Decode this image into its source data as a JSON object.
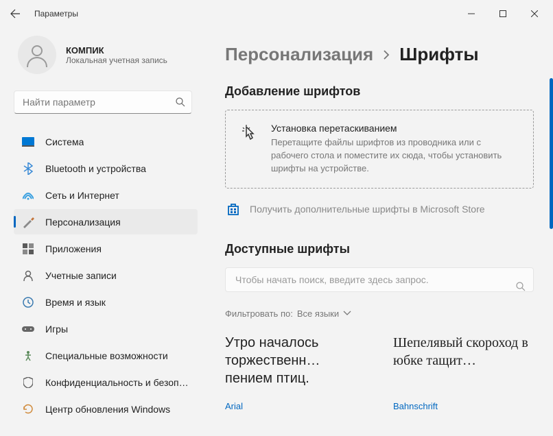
{
  "window": {
    "title": "Параметры"
  },
  "profile": {
    "name": "КОМПИК",
    "subtitle": "Локальная учетная запись"
  },
  "search": {
    "placeholder": "Найти параметр"
  },
  "nav": [
    {
      "id": "system",
      "label": "Система"
    },
    {
      "id": "bluetooth",
      "label": "Bluetooth и устройства"
    },
    {
      "id": "network",
      "label": "Сеть и Интернет"
    },
    {
      "id": "personalization",
      "label": "Персонализация"
    },
    {
      "id": "apps",
      "label": "Приложения"
    },
    {
      "id": "accounts",
      "label": "Учетные записи"
    },
    {
      "id": "time",
      "label": "Время и язык"
    },
    {
      "id": "gaming",
      "label": "Игры"
    },
    {
      "id": "accessibility",
      "label": "Специальные возможности"
    },
    {
      "id": "privacy",
      "label": "Конфиденциальность и безопасность"
    },
    {
      "id": "update",
      "label": "Центр обновления Windows"
    }
  ],
  "breadcrumb": {
    "parent": "Персонализация",
    "current": "Шрифты"
  },
  "add_section": {
    "title": "Добавление шрифтов",
    "drop_title": "Установка перетаскиванием",
    "drop_sub": "Перетащите файлы шрифтов из проводника или с рабочего стола и поместите их сюда, чтобы установить шрифты на устройстве.",
    "store_link": "Получить дополнительные шрифты в Microsoft Store"
  },
  "available_section": {
    "title": "Доступные шрифты",
    "search_placeholder": "Чтобы начать поиск, введите здесь запрос.",
    "filter_label": "Фильтровать по:",
    "filter_value": "Все языки"
  },
  "fonts": [
    {
      "sample": "Утро началось торжественн… пением птиц.",
      "name": "Arial"
    },
    {
      "sample": "Шепелявый скороход в юбке тащит…",
      "name": "Bahnschrift"
    }
  ]
}
